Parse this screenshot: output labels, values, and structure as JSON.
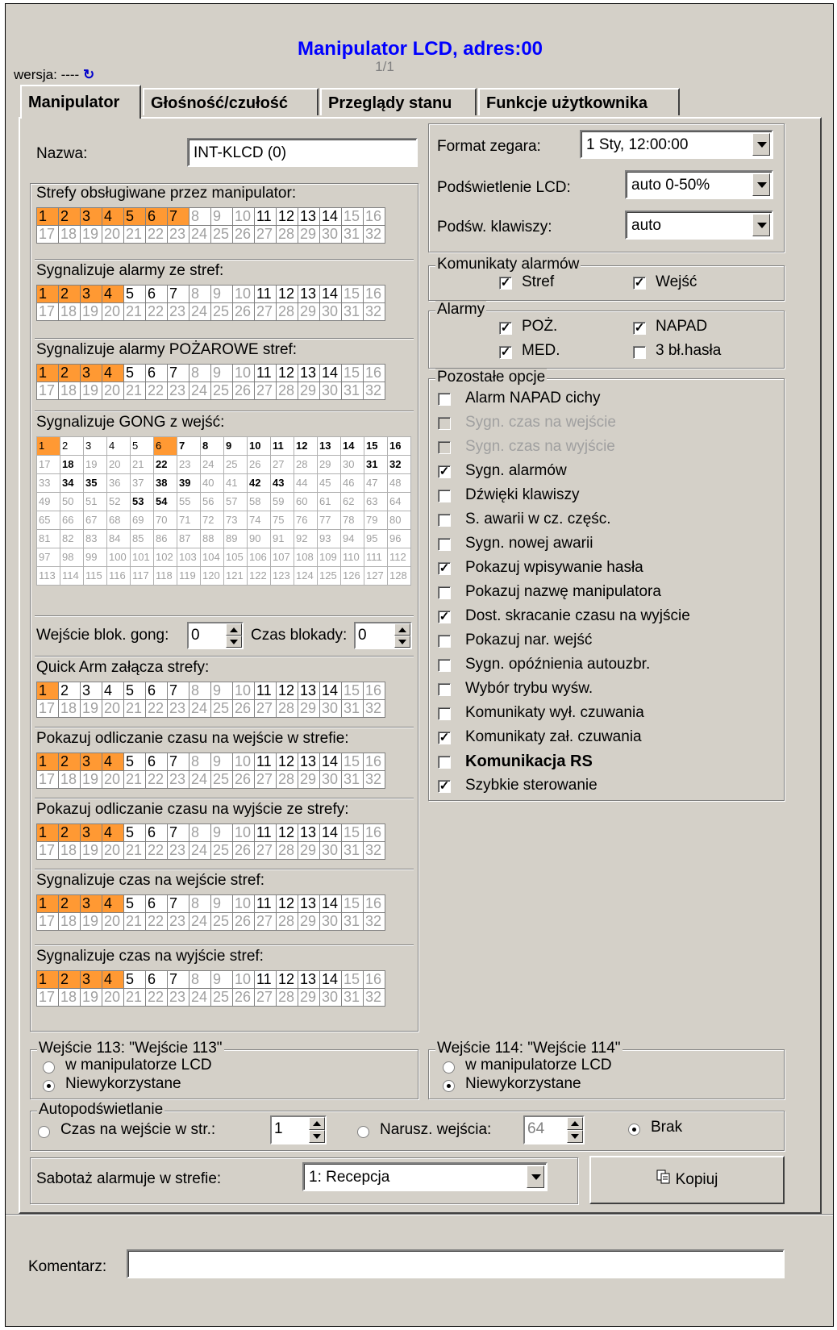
{
  "header": {
    "title": "Manipulator LCD, adres:00",
    "page": "1/1",
    "version_label": "wersja: ----",
    "sync_icon": "↻"
  },
  "tabs": [
    {
      "label": "Manipulator",
      "active": true
    },
    {
      "label": "Głośność/czułość",
      "active": false
    },
    {
      "label": "Przeglądy stanu",
      "active": false
    },
    {
      "label": "Funkcje użytkownika",
      "active": false
    }
  ],
  "name": {
    "label": "Nazwa:",
    "value": "INT-KLCD    (0)"
  },
  "grids": [
    {
      "label": "Strefy obsługiwane przez manipulator:",
      "selected": [
        1,
        2,
        3,
        4,
        5,
        6,
        7
      ],
      "enabled": [
        11,
        12,
        13,
        14
      ]
    },
    {
      "label": "Sygnalizuje alarmy ze stref:",
      "selected": [
        1,
        2,
        3,
        4
      ],
      "enabled": [
        5,
        6,
        7,
        11,
        12,
        13,
        14
      ]
    },
    {
      "label": "Sygnalizuje alarmy POŻAROWE stref:",
      "selected": [
        1,
        2,
        3,
        4
      ],
      "enabled": [
        5,
        6,
        7,
        11,
        12,
        13,
        14
      ]
    },
    {
      "label": "Quick Arm załącza strefy:",
      "selected": [
        1
      ],
      "enabled": [
        2,
        3,
        4,
        5,
        6,
        7,
        11,
        12,
        13,
        14
      ]
    },
    {
      "label": "Pokazuj odliczanie czasu na wejście w strefie:",
      "selected": [
        1,
        2,
        3,
        4
      ],
      "enabled": [
        5,
        6,
        7,
        11,
        12,
        13,
        14
      ]
    },
    {
      "label": "Pokazuj odliczanie czasu na wyjście ze strefy:",
      "selected": [
        1,
        2,
        3,
        4
      ],
      "enabled": [
        5,
        6,
        7,
        11,
        12,
        13,
        14
      ]
    },
    {
      "label": "Sygnalizuje czas na wejście stref:",
      "selected": [
        1,
        2,
        3,
        4
      ],
      "enabled": [
        5,
        6,
        7,
        11,
        12,
        13,
        14
      ]
    },
    {
      "label": "Sygnalizuje czas na wyjście stref:",
      "selected": [
        1,
        2,
        3,
        4
      ],
      "enabled": [
        5,
        6,
        7,
        11,
        12,
        13,
        14
      ]
    }
  ],
  "gong": {
    "label": "Sygnalizuje GONG z wejść:",
    "selected": [
      1,
      6
    ],
    "bold": [
      7,
      8,
      9,
      10,
      11,
      12,
      13,
      14,
      15,
      16,
      18,
      22,
      31,
      32,
      34,
      35,
      38,
      39,
      42,
      43,
      53,
      54
    ],
    "enabled": [
      2,
      3,
      4,
      5
    ]
  },
  "gong_block": {
    "label": "Wejście blok. gong:",
    "value": "0",
    "time_label": "Czas blokady:",
    "time_value": "0"
  },
  "clock": {
    "label": "Format zegara:",
    "value": "1 Sty, 12:00:00"
  },
  "lcd_backlight": {
    "label": "Podświetlenie  LCD:",
    "value": "auto 0-50%"
  },
  "key_backlight": {
    "label": "Podśw. klawiszy:",
    "value": "auto"
  },
  "alarm_messages": {
    "legend": "Komunikaty alarmów",
    "items": [
      {
        "label": "Stref",
        "checked": true
      },
      {
        "label": "Wejść",
        "checked": true
      }
    ]
  },
  "alarms": {
    "legend": "Alarmy",
    "items": [
      {
        "label": "POŻ.",
        "checked": true
      },
      {
        "label": "NAPAD",
        "checked": true
      },
      {
        "label": "MED.",
        "checked": true
      },
      {
        "label": "3 bł.hasła",
        "checked": false
      }
    ]
  },
  "other_options": {
    "legend": "Pozostałe opcje",
    "items": [
      {
        "label": "Alarm NAPAD cichy",
        "checked": false,
        "disabled": false,
        "bold": false
      },
      {
        "label": "Sygn. czas na wejście",
        "checked": false,
        "disabled": true,
        "bold": false
      },
      {
        "label": "Sygn. czas na wyjście",
        "checked": false,
        "disabled": true,
        "bold": false
      },
      {
        "label": "Sygn. alarmów",
        "checked": true,
        "disabled": false,
        "bold": false
      },
      {
        "label": "Dźwięki klawiszy",
        "checked": false,
        "disabled": false,
        "bold": false
      },
      {
        "label": "S. awarii w cz. częśc.",
        "checked": false,
        "disabled": false,
        "bold": false
      },
      {
        "label": "Sygn. nowej awarii",
        "checked": false,
        "disabled": false,
        "bold": false
      },
      {
        "label": "Pokazuj wpisywanie hasła",
        "checked": true,
        "disabled": false,
        "bold": false
      },
      {
        "label": "Pokazuj nazwę manipulatora",
        "checked": false,
        "disabled": false,
        "bold": false
      },
      {
        "label": "Dost. skracanie czasu na wyjście",
        "checked": true,
        "disabled": false,
        "bold": false
      },
      {
        "label": "Pokazuj nar. wejść",
        "checked": false,
        "disabled": false,
        "bold": false
      },
      {
        "label": "Sygn. opóźnienia autouzbr.",
        "checked": false,
        "disabled": false,
        "bold": false
      },
      {
        "label": "Wybór trybu wyśw.",
        "checked": false,
        "disabled": false,
        "bold": false
      },
      {
        "label": "Komunikaty wył. czuwania",
        "checked": false,
        "disabled": false,
        "bold": false
      },
      {
        "label": "Komunikaty zał. czuwania",
        "checked": true,
        "disabled": false,
        "bold": false
      },
      {
        "label": "Komunikacja RS",
        "checked": false,
        "disabled": false,
        "bold": true
      },
      {
        "label": "Szybkie sterowanie",
        "checked": true,
        "disabled": false,
        "bold": false
      }
    ]
  },
  "input113": {
    "legend": "Wejście 113: \"Wejście 113\"",
    "opt1": "w manipulatorze LCD",
    "opt2": "Niewykorzystane",
    "selected": 2
  },
  "input114": {
    "legend": "Wejście 114: \"Wejście 114\"",
    "opt1": "w manipulatorze LCD",
    "opt2": "Niewykorzystane",
    "selected": 2
  },
  "autobacklight": {
    "legend": "Autopodświetlanie",
    "opt1": "Czas na wejście w str.:",
    "opt1_value": "1",
    "opt2": "Narusz. wejścia:",
    "opt2_value": "64",
    "opt3": "Brak",
    "selected": 3
  },
  "sabotage": {
    "label": "Sabotaż alarmuje w strefie:",
    "value": "1: Recepcja"
  },
  "copy_button": {
    "label": "Kopiuj",
    "icon": "copy-icon"
  },
  "comment": {
    "label": "Komentarz:",
    "value": ""
  },
  "colors": {
    "title": "#0000ff",
    "selected_cell": "#ff9933",
    "window_bg": "#d4d0c8"
  }
}
